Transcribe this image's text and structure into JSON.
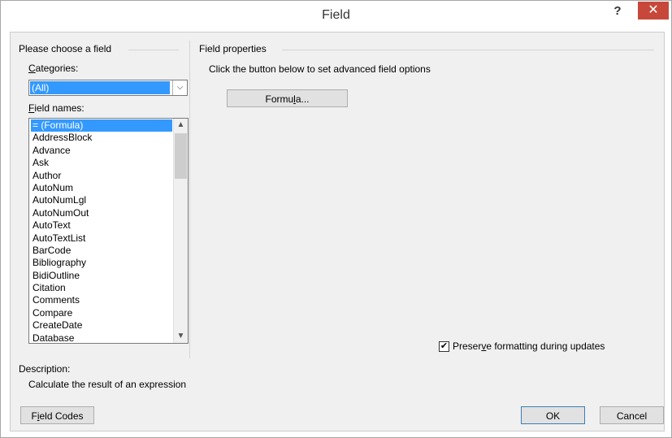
{
  "window": {
    "title": "Field",
    "help_label": "?",
    "close_label": "✕"
  },
  "left": {
    "group_title": "Please choose a field",
    "categories_label": {
      "pre": "",
      "key": "C",
      "post": "ategories:"
    },
    "categories_value": "(All)",
    "field_names_label": {
      "pre": "",
      "key": "F",
      "post": "ield names:"
    },
    "field_names": [
      "= (Formula)",
      "AddressBlock",
      "Advance",
      "Ask",
      "Author",
      "AutoNum",
      "AutoNumLgl",
      "AutoNumOut",
      "AutoText",
      "AutoTextList",
      "BarCode",
      "Bibliography",
      "BidiOutline",
      "Citation",
      "Comments",
      "Compare",
      "CreateDate",
      "Database"
    ],
    "selected_index": 0
  },
  "right": {
    "group_title": "Field properties",
    "instruction": "Click the button below to set advanced field options",
    "formula_button": {
      "pre": "Formu",
      "key": "l",
      "post": "a..."
    },
    "preserve_checked": true,
    "preserve_label": {
      "pre": "Preser",
      "key": "v",
      "post": "e formatting during updates"
    }
  },
  "description": {
    "label": "Description:",
    "text": "Calculate the result of an expression"
  },
  "footer": {
    "field_codes_button": {
      "pre": "F",
      "key": "i",
      "post": "eld Codes"
    },
    "ok_label": "OK",
    "cancel_label": "Cancel"
  },
  "icons": {
    "dropdown": "chevron-down-icon",
    "scroll_up": "chevron-up-icon",
    "scroll_down": "chevron-down-icon",
    "checkmark": "checkmark-icon"
  },
  "colors": {
    "selection": "#3399ff",
    "close_button": "#c7483a"
  }
}
